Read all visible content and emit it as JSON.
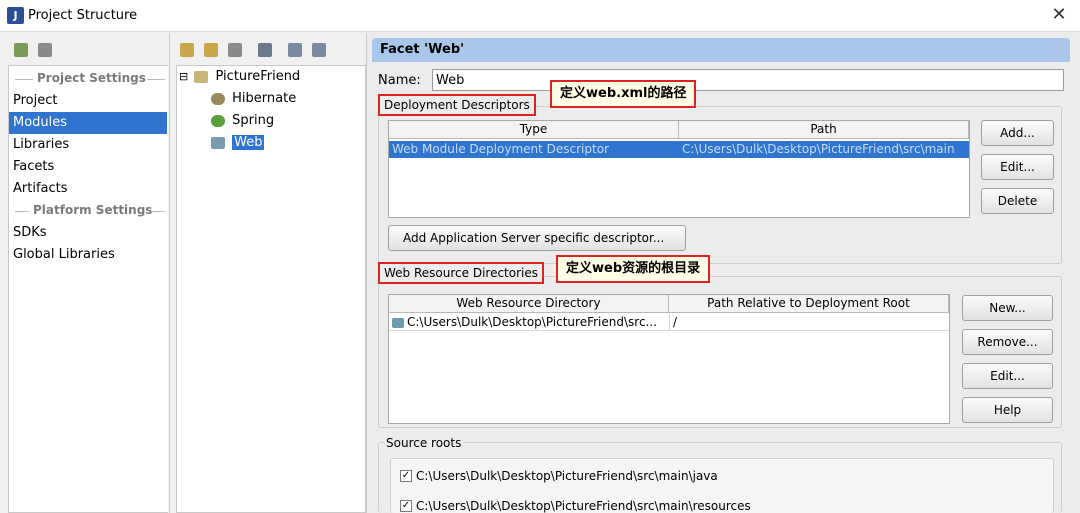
{
  "window": {
    "title": "Project Structure",
    "close_glyph": "✕",
    "app_icon_glyph": "J"
  },
  "left_panel": {
    "project_settings_header": "Project Settings",
    "platform_settings_header": "Platform Settings",
    "project_items": [
      "Project",
      "Modules",
      "Libraries",
      "Facets",
      "Artifacts"
    ],
    "platform_items": [
      "SDKs",
      "Global Libraries"
    ],
    "selected_item": "Modules"
  },
  "tree": {
    "root": "PictureFriend",
    "children": [
      "Hibernate",
      "Spring",
      "Web"
    ],
    "selected": "Web",
    "expand_glyph": "⊟"
  },
  "facet": {
    "header": "Facet 'Web'",
    "name_label": "Name:",
    "name_value": "Web"
  },
  "deployment": {
    "title": "Deployment Descriptors",
    "columns": [
      "Type",
      "Path"
    ],
    "rows": [
      {
        "type": "Web Module Deployment Descriptor",
        "path": "C:\\Users\\Dulk\\Desktop\\PictureFriend\\src\\main"
      }
    ],
    "buttons": [
      "Add...",
      "Edit...",
      "Delete"
    ],
    "add_server_button": "Add Application Server specific descriptor..."
  },
  "web_resources": {
    "title": "Web Resource Directories",
    "columns": [
      "Web Resource Directory",
      "Path Relative to Deployment Root"
    ],
    "rows": [
      {
        "directory": "C:\\Users\\Dulk\\Desktop\\PictureFriend\\src...",
        "path": "/"
      }
    ],
    "buttons": [
      "New...",
      "Remove...",
      "Edit...",
      "Help"
    ]
  },
  "source_roots": {
    "title": "Source roots",
    "items": [
      "C:\\Users\\Dulk\\Desktop\\PictureFriend\\src\\main\\java",
      "C:\\Users\\Dulk\\Desktop\\PictureFriend\\src\\main\\resources"
    ],
    "check_glyph": "✓"
  },
  "callouts": {
    "web_xml": "定义web.xml的路径",
    "web_resources": "定义web资源的根目录"
  },
  "colors": {
    "selection": "#2f74cf",
    "facet_header": "#a9c7ea",
    "annotation_border": "#dd2222"
  }
}
